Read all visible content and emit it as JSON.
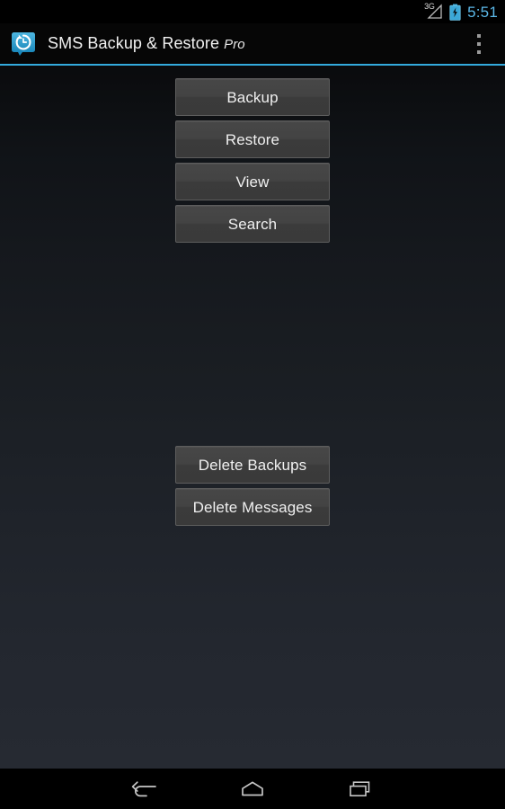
{
  "status_bar": {
    "network_label": "3G",
    "network_icon": "signal-triangle-icon",
    "battery_icon": "battery-charging-icon",
    "time": "5:51",
    "time_color": "#5bb8e8"
  },
  "action_bar": {
    "app_icon": "sms-backup-restore-app-icon",
    "title": "SMS Backup & Restore",
    "title_suffix": "Pro",
    "overflow_icon": "overflow-menu-icon",
    "accent_color": "#33aadd"
  },
  "main": {
    "primary_actions": [
      {
        "label": "Backup"
      },
      {
        "label": "Restore"
      },
      {
        "label": "View"
      },
      {
        "label": "Search"
      }
    ],
    "destructive_actions": [
      {
        "label": "Delete Backups"
      },
      {
        "label": "Delete Messages"
      }
    ]
  },
  "navigation_bar": {
    "items": [
      {
        "icon": "back-icon"
      },
      {
        "icon": "home-icon"
      },
      {
        "icon": "recents-icon"
      }
    ]
  }
}
